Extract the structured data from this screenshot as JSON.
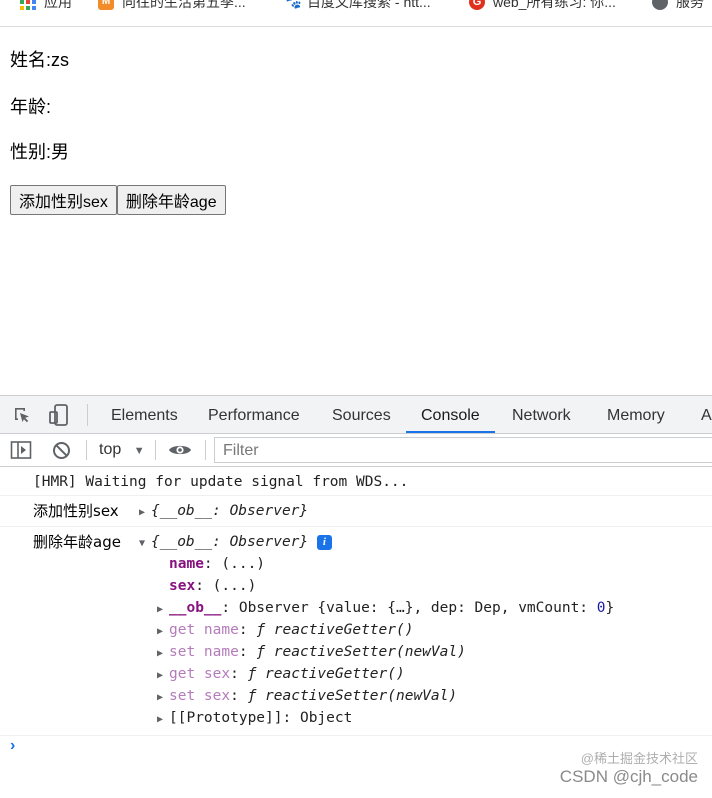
{
  "bookmarks": [
    {
      "label": "应用",
      "icon": "apps-icon"
    },
    {
      "label": "向往的生活第五季...",
      "icon": "mango-tv-icon"
    },
    {
      "label": "百度文库搜索 - htt...",
      "icon": "baidu-paw-icon"
    },
    {
      "label": "web_所有练习: 你...",
      "icon": "gitee-icon"
    },
    {
      "label": "服务",
      "icon": "globe-icon"
    }
  ],
  "page": {
    "name_line": "姓名:zs",
    "age_line": "年龄:",
    "sex_line": "性别:男",
    "add_sex_button": "添加性别sex",
    "delete_age_button": "删除年龄age"
  },
  "devtools": {
    "tabs": [
      "Elements",
      "Performance",
      "Sources",
      "Console",
      "Network",
      "Memory",
      "A"
    ],
    "active_tab": "Console",
    "context": "top",
    "filter_placeholder": "Filter",
    "console": {
      "hmr": "[HMR] Waiting for update signal from WDS...",
      "log1_label": "添加性别sex",
      "log1_obj": "{__ob__: Observer}",
      "log2_label": "删除年龄age",
      "log2_obj": "{__ob__: Observer}",
      "info_badge": "i",
      "props": {
        "name_key": "name",
        "name_val": ": (...)",
        "sex_key": "sex",
        "sex_val": ": (...)",
        "ob_key": "__ob__",
        "ob_val_a": ": Observer {value: {…}, dep: Dep, vmCount: ",
        "ob_val_num": "0",
        "ob_val_b": "}",
        "get_name_key": "get name",
        "get_name_val": "ƒ reactiveGetter()",
        "set_name_key": "set name",
        "set_name_val": "ƒ reactiveSetter(newVal)",
        "get_sex_key": "get sex",
        "get_sex_val": "ƒ reactiveGetter()",
        "set_sex_key": "set sex",
        "set_sex_val": "ƒ reactiveSetter(newVal)",
        "proto_key": "[[Prototype]]",
        "proto_val": ": Object"
      },
      "prompt_symbol": "›"
    }
  },
  "watermark": {
    "line1": "@稀土掘金技术社区",
    "line2": "CSDN @cjh_code"
  },
  "colors": {
    "accent": "#1a73e8",
    "property_key": "#881280"
  }
}
